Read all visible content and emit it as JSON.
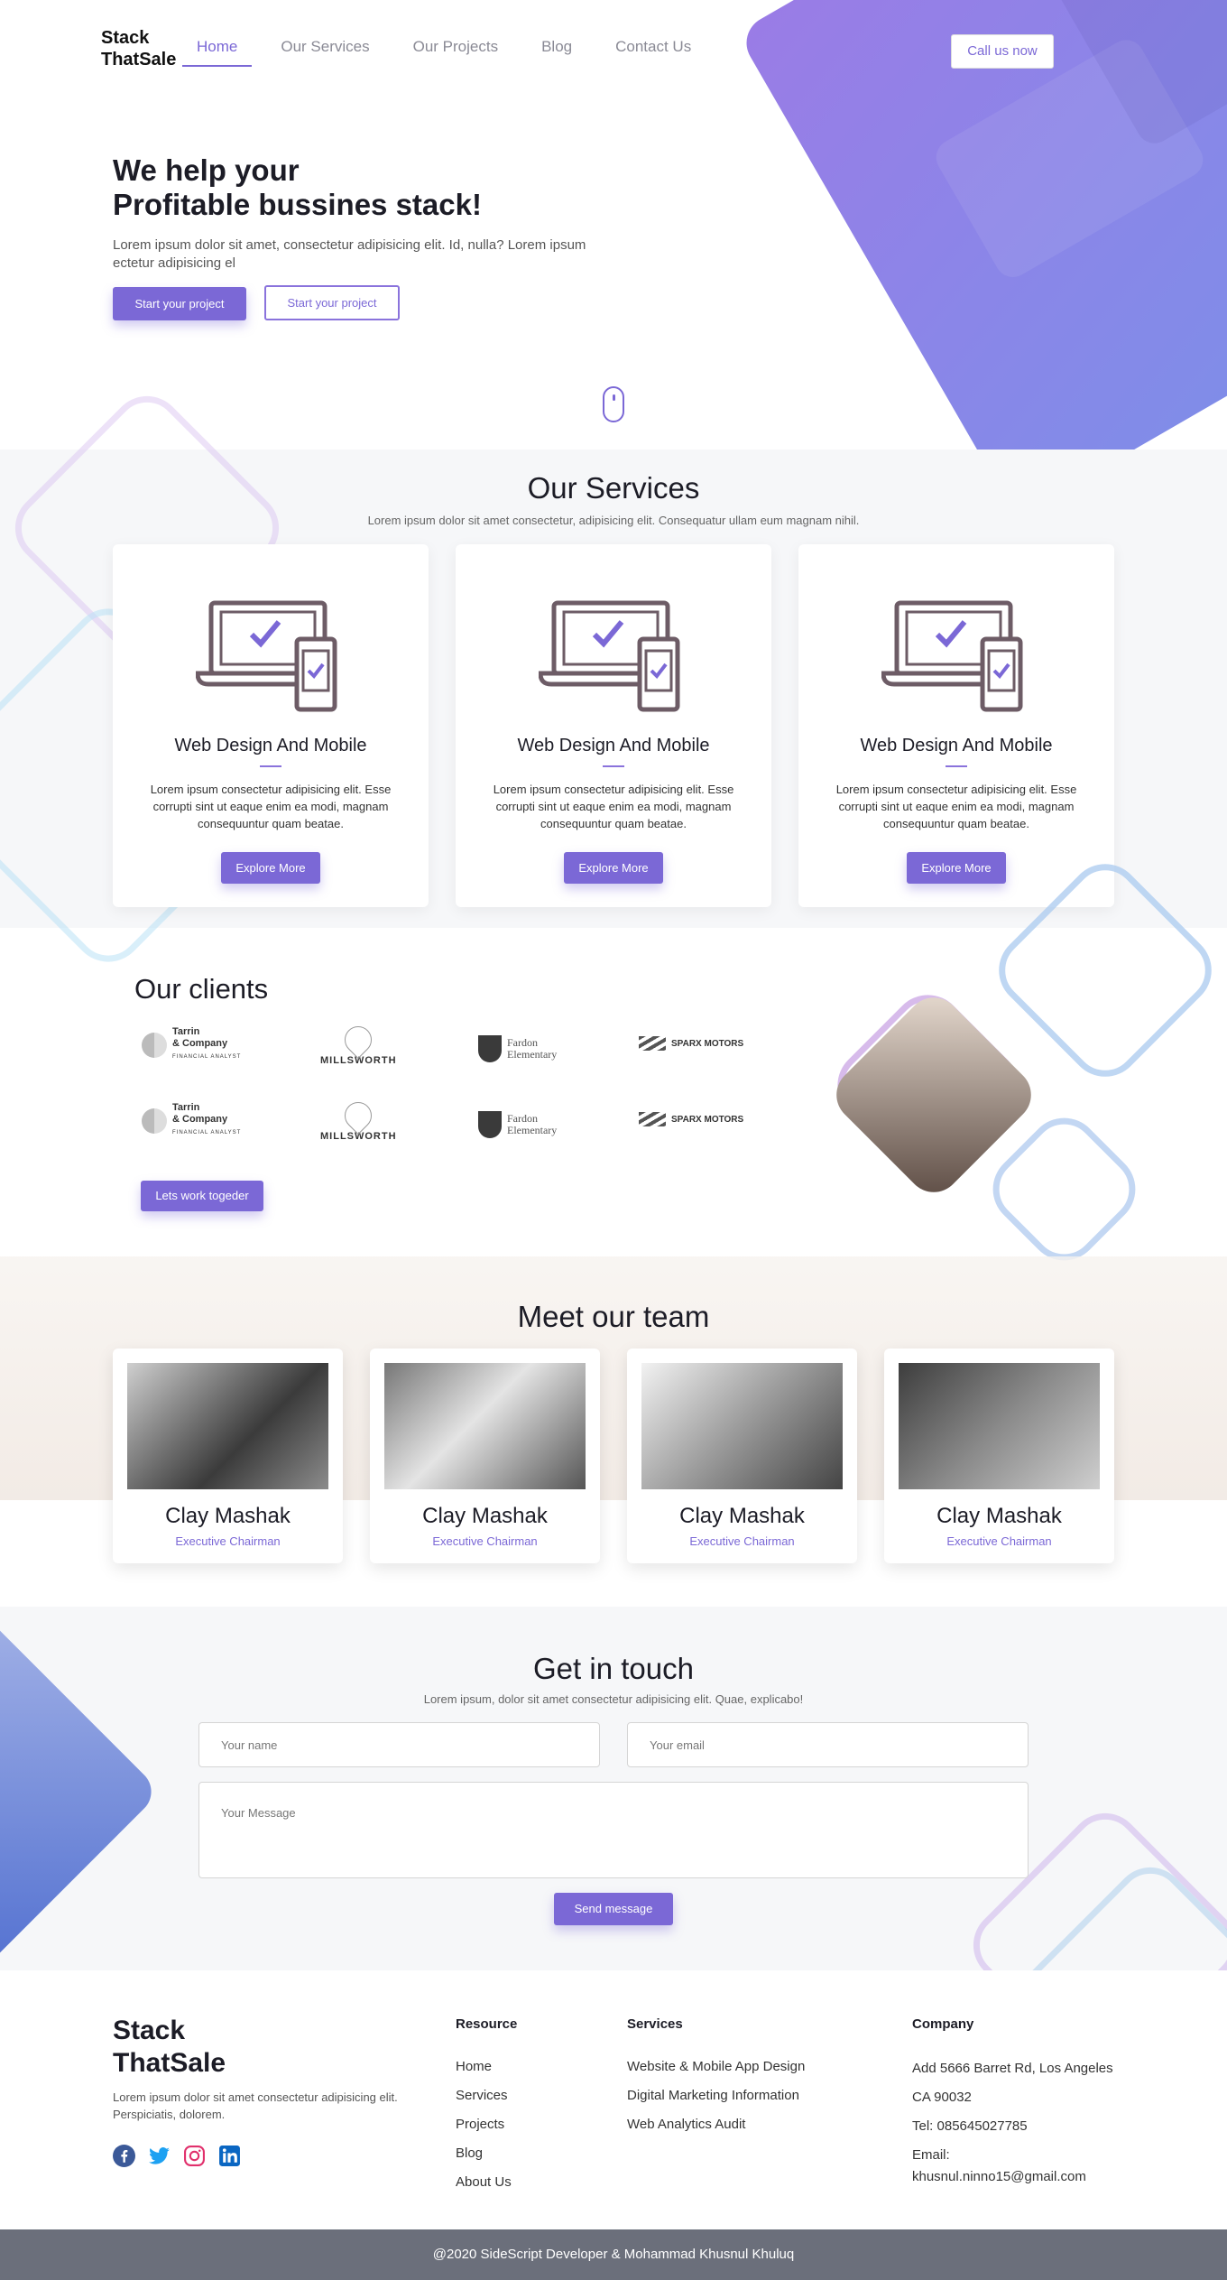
{
  "header": {
    "logo_line1": "Stack",
    "logo_line2": "ThatSale",
    "nav": [
      "Home",
      "Our Services",
      "Our Projects",
      "Blog",
      "Contact Us"
    ],
    "active_nav": "Home",
    "call_button": "Call us now"
  },
  "hero": {
    "title_line1": "We help your",
    "title_line2": "Profitable bussines stack!",
    "text": "Lorem ipsum dolor sit amet, consectetur adipisicing elit. Id, nulla? Lorem ipsum ectetur adipisicing el",
    "primary_button": "Start your project",
    "secondary_button": "Start your project"
  },
  "services": {
    "title": "Our Services",
    "subtitle": "Lorem ipsum dolor sit amet consectetur, adipisicing elit. Consequatur ullam eum magnam nihil.",
    "cards": [
      {
        "title": "Web Design And Mobile",
        "text": "Lorem ipsum consectetur adipisicing elit. Esse corrupti sint ut eaque enim ea modi, magnam consequuntur quam beatae.",
        "button": "Explore More"
      },
      {
        "title": "Web Design And Mobile",
        "text": "Lorem ipsum consectetur adipisicing elit. Esse corrupti sint ut eaque enim ea modi, magnam consequuntur quam beatae.",
        "button": "Explore More"
      },
      {
        "title": "Web Design And Mobile",
        "text": "Lorem ipsum consectetur adipisicing elit. Esse corrupti sint ut eaque enim ea modi, magnam consequuntur quam beatae.",
        "button": "Explore More"
      }
    ]
  },
  "clients": {
    "title": "Our clients",
    "logos": [
      {
        "line1": "Tarrin",
        "line2": "& Company",
        "line3": "FINANCIAL ANALYST"
      },
      {
        "line1": "MILLSWORTH",
        "line2": "",
        "line3": ""
      },
      {
        "line1": "Fardon",
        "line2": "Elementary",
        "line3": ""
      },
      {
        "line1": "SPARX MOTORS",
        "line2": "",
        "line3": ""
      }
    ],
    "button": "Lets work togeder"
  },
  "team": {
    "title": "Meet our team",
    "members": [
      {
        "name": "Clay Mashak",
        "role": "Executive Chairman"
      },
      {
        "name": "Clay Mashak",
        "role": "Executive Chairman"
      },
      {
        "name": "Clay Mashak",
        "role": "Executive Chairman"
      },
      {
        "name": "Clay Mashak",
        "role": "Executive Chairman"
      }
    ]
  },
  "contact": {
    "title": "Get in touch",
    "subtitle": "Lorem ipsum, dolor sit amet consectetur adipisicing elit. Quae, explicabo!",
    "name_placeholder": "Your name",
    "email_placeholder": "Your email",
    "message_placeholder": "Your Message",
    "button": "Send message"
  },
  "footer": {
    "logo_line1": "Stack",
    "logo_line2": "ThatSale",
    "about": "Lorem ipsum dolor sit amet consectetur adipisicing elit. Perspiciatis, dolorem.",
    "social_icons": [
      "facebook-icon",
      "twitter-icon",
      "instagram-icon",
      "linkedin-icon"
    ],
    "resource_title": "Resource",
    "resource_links": [
      "Home",
      "Services",
      "Projects",
      "Blog",
      "About Us"
    ],
    "services_title": "Services",
    "services_links": [
      "Website & Mobile App Design",
      "Digital Marketing Information",
      "Web Analytics Audit"
    ],
    "company_title": "Company",
    "address": "Add 5666 Barret Rd, Los Angeles",
    "city": "CA 90032",
    "tel": "Tel: 085645027785",
    "email_label": "Email:",
    "email": "khusnul.ninno15@gmail.com",
    "copyright": "@2020 SideScript Developer & Mohammad Khusnul Khuluq"
  },
  "colors": {
    "accent": "#7b68d6",
    "footer_bar": "#6b6f7b",
    "section_bg": "#f6f7f9"
  }
}
